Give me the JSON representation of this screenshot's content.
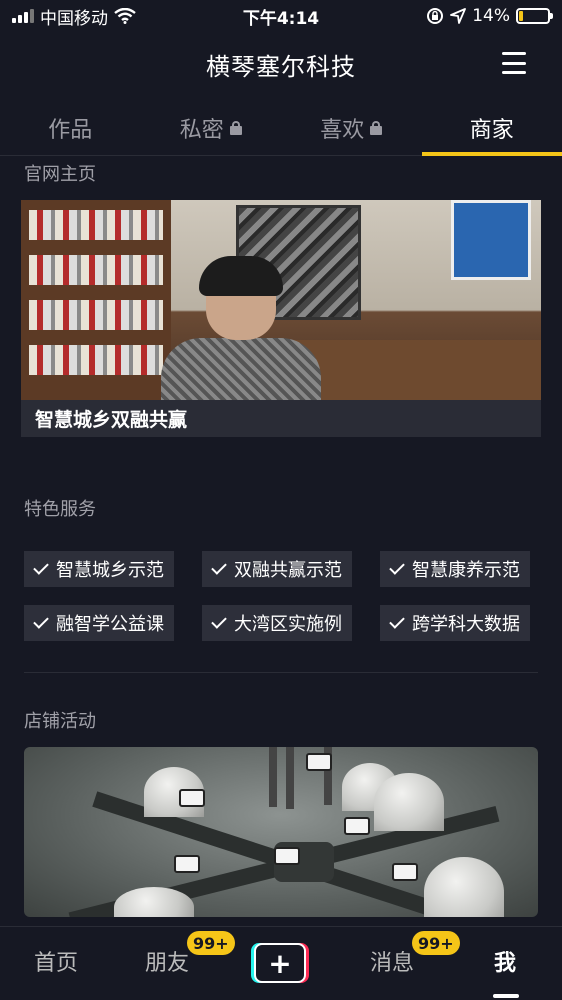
{
  "status_bar": {
    "carrier": "中国移动",
    "time": "下午4:14",
    "battery_percent": "14%",
    "battery_level": 0.14
  },
  "header": {
    "title": "横琴塞尔科技"
  },
  "tabs": [
    {
      "label": "作品",
      "locked": false,
      "active": false
    },
    {
      "label": "私密",
      "locked": true,
      "active": false
    },
    {
      "label": "喜欢",
      "locked": true,
      "active": false
    },
    {
      "label": "商家",
      "locked": false,
      "active": true
    }
  ],
  "official": {
    "section_title": "官网主页",
    "caption": "智慧城乡双融共赢"
  },
  "services": {
    "section_title": "特色服务",
    "items": [
      "智慧城乡示范",
      "双融共赢示范",
      "智慧康养示范",
      "融智学公益课",
      "大湾区实施例",
      "跨学科大数据"
    ]
  },
  "shop": {
    "section_title": "店铺活动"
  },
  "bottom_nav": {
    "home": "首页",
    "friends": "朋友",
    "friends_badge": "99+",
    "plus": "+",
    "messages": "消息",
    "messages_badge": "99+",
    "me": "我"
  },
  "colors": {
    "background": "#161823",
    "accent": "#f5c518",
    "tag_bg": "#2d2f3a"
  }
}
